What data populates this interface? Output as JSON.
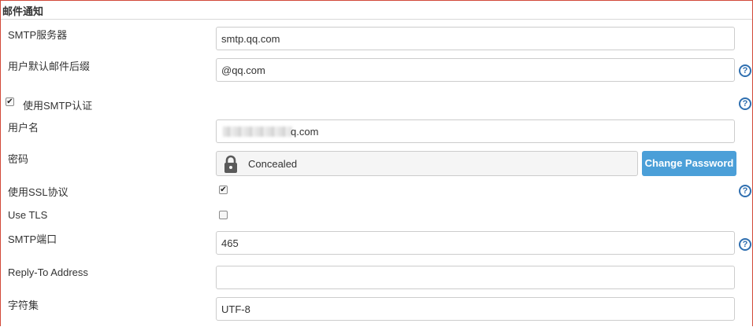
{
  "section": {
    "title": "邮件通知"
  },
  "fields": {
    "smtp_server": {
      "label": "SMTP服务器",
      "value": "smtp.qq.com"
    },
    "default_suffix": {
      "label": "用户默认邮件后缀",
      "value": "@qq.com"
    },
    "use_smtp_auth": {
      "label": "使用SMTP认证",
      "checked": true
    },
    "username": {
      "label": "用户名",
      "value_visible_suffix": "q.com"
    },
    "password": {
      "label": "密码",
      "status": "Concealed",
      "button_label": "Change Password"
    },
    "use_ssl": {
      "label": "使用SSL协议",
      "checked": true
    },
    "use_tls": {
      "label": "Use TLS",
      "checked": false
    },
    "smtp_port": {
      "label": "SMTP端口",
      "value": "465"
    },
    "reply_to": {
      "label": "Reply-To Address",
      "value": ""
    },
    "charset": {
      "label": "字符集",
      "value": "UTF-8"
    }
  },
  "help_glyph": "?",
  "check_glyph": "✔",
  "icons": {
    "help": "help-icon",
    "lock": "lock-icon"
  },
  "colors": {
    "frame": "#d24939",
    "help": "#2f6fb0",
    "button": "#4b9fd8"
  }
}
